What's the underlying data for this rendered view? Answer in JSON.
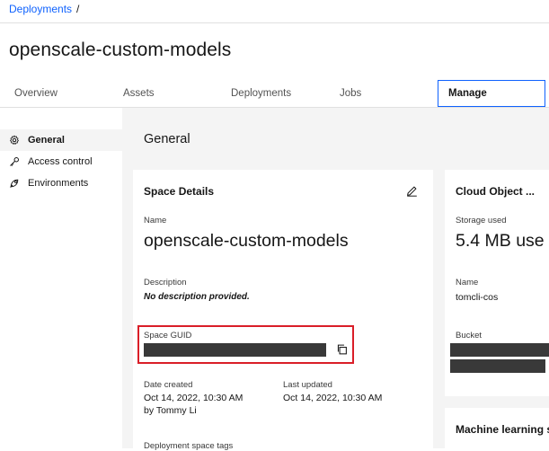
{
  "breadcrumb": {
    "link": "Deployments",
    "separator": "/"
  },
  "page_title": "openscale-custom-models",
  "tabs": [
    {
      "label": "Overview"
    },
    {
      "label": "Assets"
    },
    {
      "label": "Deployments"
    },
    {
      "label": "Jobs"
    },
    {
      "label": "Manage",
      "active": true
    }
  ],
  "sidebar": {
    "items": [
      {
        "label": "General",
        "icon": "gear-icon",
        "active": true
      },
      {
        "label": "Access control",
        "icon": "key-icon"
      },
      {
        "label": "Environments",
        "icon": "environment-icon"
      }
    ]
  },
  "main": {
    "heading": "General",
    "space_details": {
      "title": "Space Details",
      "edit_icon": "edit-icon",
      "name_label": "Name",
      "name_value": "openscale-custom-models",
      "description_label": "Description",
      "description_value": "No description provided.",
      "guid_label": "Space GUID",
      "copy_icon": "copy-icon",
      "date_created_label": "Date created",
      "date_created_value": "Oct 14, 2022, 10:30 AM",
      "created_by": "by Tommy Li",
      "last_updated_label": "Last updated",
      "last_updated_value": "Oct 14, 2022, 10:30 AM",
      "tags_label": "Deployment space tags"
    },
    "cloud_object": {
      "title": "Cloud Object ...",
      "storage_label": "Storage used",
      "storage_value": "5.4 MB use",
      "name_label": "Name",
      "name_value": "tomcli-cos",
      "bucket_label": "Bucket"
    },
    "ml_card": {
      "title": "Machine learning s"
    }
  },
  "colors": {
    "accent": "#0f62fe",
    "highlight": "#da1e28",
    "redaction": "#393939",
    "main_bg": "#f4f4f4"
  }
}
